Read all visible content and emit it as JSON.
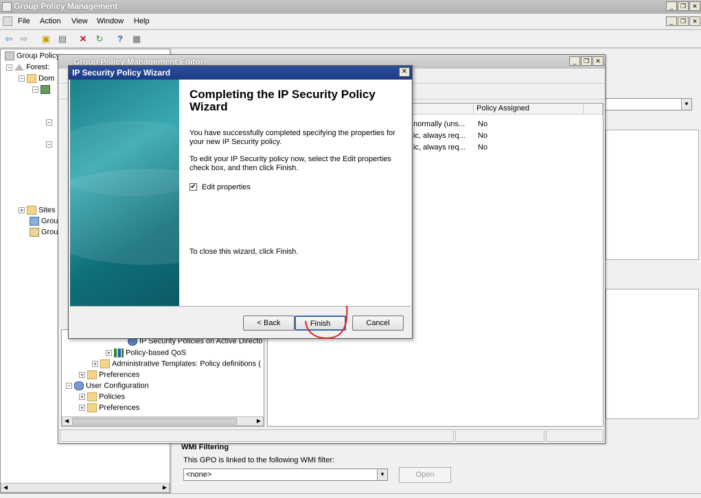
{
  "main_window": {
    "title": "Group Policy Management",
    "controls": {
      "minimize": "_",
      "restore": "❐",
      "close": "✕"
    },
    "menu": [
      "File",
      "Action",
      "View",
      "Window",
      "Help"
    ]
  },
  "left_tree": {
    "items": [
      {
        "label": "Group Policy",
        "toggle": ""
      },
      {
        "label": "Forest:",
        "toggle": "−"
      },
      {
        "label": "Dom",
        "toggle": "−"
      },
      {
        "label": "",
        "toggle": "−"
      },
      {
        "label": "",
        "toggle": "−"
      },
      {
        "label": "",
        "toggle": "−"
      },
      {
        "label": "Sites",
        "toggle": "+"
      },
      {
        "label": "Grou",
        "toggle": ""
      },
      {
        "label": "Grou",
        "toggle": ""
      }
    ]
  },
  "editor": {
    "title": "Group Policy Management Editor",
    "list_headers": [
      "Policy Assigned"
    ],
    "list_rows": [
      {
        "description": "normally (uns...",
        "assigned": "No"
      },
      {
        "description": "ic, always req...",
        "assigned": "No"
      },
      {
        "description": "ic, always req...",
        "assigned": "No"
      }
    ],
    "tree": [
      {
        "label": "IP Security Policies on Active Directo",
        "toggle": "",
        "indent": 0
      },
      {
        "label": "Policy-based QoS",
        "toggle": "+",
        "indent": 1
      },
      {
        "label": "Administrative Templates: Policy definitions (",
        "toggle": "+",
        "indent": 2
      },
      {
        "label": "Preferences",
        "toggle": "+",
        "indent": 3
      },
      {
        "label": "User Configuration",
        "toggle": "−",
        "indent": 4
      },
      {
        "label": "Policies",
        "toggle": "+",
        "indent": 3
      },
      {
        "label": "Preferences",
        "toggle": "+",
        "indent": 3
      }
    ]
  },
  "wizard": {
    "title": "IP Security Policy Wizard",
    "close": "✕",
    "heading": "Completing the IP Security Policy Wizard",
    "text1": "You have successfully completed specifying the properties for your new IP Security policy.",
    "text2": "To edit your IP Security policy now, select the Edit properties check box, and then click Finish.",
    "checkbox_label": "Edit properties",
    "checkbox_checked": true,
    "close_text": "To close this wizard, click Finish.",
    "buttons": {
      "back": "< Back",
      "finish": "Finish",
      "cancel": "Cancel"
    }
  },
  "wmi": {
    "heading": "WMI Filtering",
    "label": "This GPO is linked to the following WMI filter:",
    "select_value": "<none>",
    "open_button": "Open"
  },
  "colors": {
    "wizard_title": "#1d3a86",
    "annotation": "#e02020",
    "wizard_side": "#1c7f8a"
  }
}
